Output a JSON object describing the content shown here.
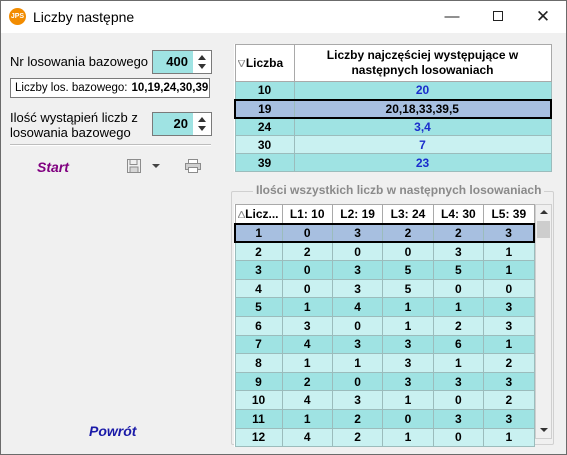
{
  "window": {
    "title": "Liczby następne",
    "icon_text": "JPS"
  },
  "left": {
    "base_draw_label": "Nr losowania bazowego",
    "base_draw_value": "400",
    "base_numbers_label": "Liczby los. bazowego:",
    "base_numbers_value": "10,19,24,30,39",
    "occurrences_label_line1": "Ilość wystąpień liczb z",
    "occurrences_label_line2": "losowania bazowego",
    "occurrences_value": "20",
    "start_label": "Start",
    "back_label": "Powrót",
    "icons": [
      "save-icon",
      "dropdown-arrow-icon",
      "print-icon"
    ]
  },
  "top_table": {
    "headers": [
      "Liczba",
      "Liczby najczęściej występujące w następnych losowaniach"
    ],
    "rows": [
      {
        "number": "10",
        "values": "20"
      },
      {
        "number": "19",
        "values": "20,18,33,39,5"
      },
      {
        "number": "24",
        "values": "3,4"
      },
      {
        "number": "30",
        "values": "7"
      },
      {
        "number": "39",
        "values": "23"
      }
    ],
    "selected_index": 1
  },
  "bottom_group": {
    "title": "Ilości wszystkich liczb w następnych losowaniach",
    "headers": [
      "Licz...",
      "L1: 10",
      "L2: 19",
      "L3: 24",
      "L4: 30",
      "L5: 39"
    ],
    "rows": [
      [
        "1",
        "0",
        "3",
        "2",
        "2",
        "3"
      ],
      [
        "2",
        "2",
        "0",
        "0",
        "3",
        "1"
      ],
      [
        "3",
        "0",
        "3",
        "5",
        "5",
        "1"
      ],
      [
        "4",
        "0",
        "3",
        "5",
        "0",
        "0"
      ],
      [
        "5",
        "1",
        "4",
        "1",
        "1",
        "3"
      ],
      [
        "6",
        "3",
        "0",
        "1",
        "2",
        "3"
      ],
      [
        "7",
        "4",
        "3",
        "3",
        "6",
        "1"
      ],
      [
        "8",
        "1",
        "1",
        "3",
        "1",
        "2"
      ],
      [
        "9",
        "2",
        "0",
        "3",
        "3",
        "3"
      ],
      [
        "10",
        "4",
        "3",
        "1",
        "0",
        "2"
      ],
      [
        "11",
        "1",
        "2",
        "0",
        "3",
        "3"
      ],
      [
        "12",
        "4",
        "2",
        "1",
        "0",
        "1"
      ]
    ],
    "selected_index": 0
  },
  "colors": {
    "cell_dark": "#9fe3e3",
    "cell_light": "#c9f1f1",
    "selected_row": "#a7bfe0",
    "value_blue": "#1a2dcc",
    "start_purple": "#800080",
    "back_blue": "#1a1aa8"
  }
}
